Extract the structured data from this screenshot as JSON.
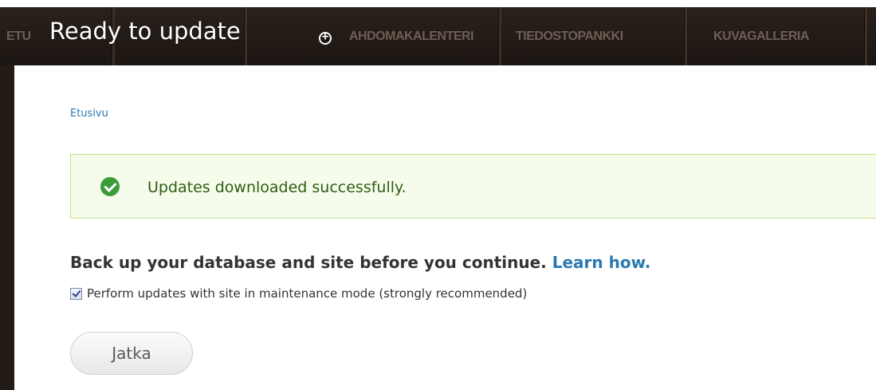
{
  "nav": {
    "items": [
      {
        "label": "ETU"
      },
      {
        "label": "AHDOMAKALENTERI"
      },
      {
        "label": "TIEDOSTOPANKKI"
      },
      {
        "label": "KUVAGALLERIA"
      }
    ]
  },
  "overlay": {
    "title": "Ready to update",
    "toggle_symbol": "+"
  },
  "breadcrumb": {
    "home": "Etusivu"
  },
  "message": {
    "status": "success",
    "icon": "check-circle-icon",
    "text": "Updates downloaded successfully."
  },
  "warning": {
    "text": "Back up your database and site before you continue.",
    "link": "Learn how."
  },
  "maintenance": {
    "checked": true,
    "label": "Perform updates with site in maintenance mode (strongly recommended)"
  },
  "actions": {
    "continue_label": "Jatka"
  },
  "colors": {
    "link": "#2a7ab0",
    "success_bg": "#f6fcec",
    "success_border": "#bfe08c",
    "success_icon": "#3a9b38",
    "nav_bg": "#1c1612"
  }
}
